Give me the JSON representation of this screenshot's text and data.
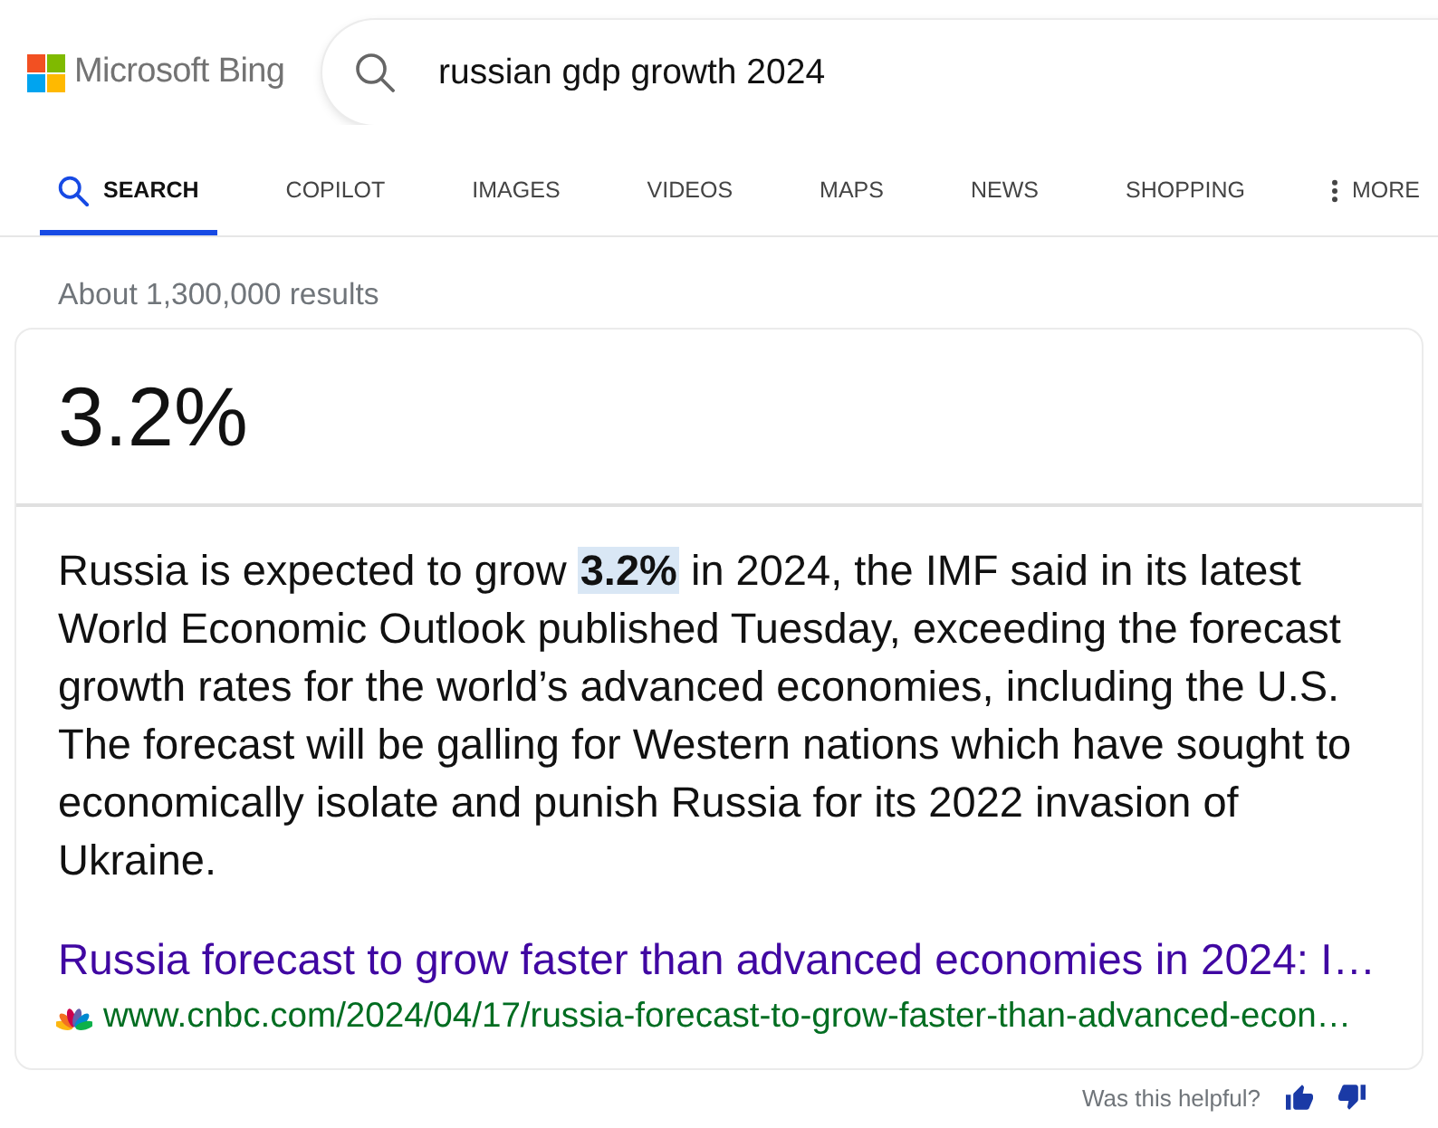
{
  "header": {
    "logo": {
      "text": "Microsoft Bing"
    },
    "search": {
      "value": "russian gdp growth 2024"
    }
  },
  "tabs": [
    {
      "label": "SEARCH",
      "kind": "search",
      "selected": true
    },
    {
      "label": "COPILOT",
      "kind": "plain",
      "selected": false
    },
    {
      "label": "IMAGES",
      "kind": "plain",
      "selected": false
    },
    {
      "label": "VIDEOS",
      "kind": "plain",
      "selected": false
    },
    {
      "label": "MAPS",
      "kind": "plain",
      "selected": false
    },
    {
      "label": "NEWS",
      "kind": "plain",
      "selected": false
    },
    {
      "label": "SHOPPING",
      "kind": "plain",
      "selected": false
    },
    {
      "label": "MORE",
      "kind": "more",
      "selected": false
    }
  ],
  "results_count": "About 1,300,000 results",
  "answer": {
    "value": "3.2%",
    "snippet": "Russia is expected to grow **3.2%** in 2024, the IMF said in its latest World Economic Outlook published Tuesday, exceeding the forecast growth rates for the world’s advanced economies, including the U.S. The forecast will be galling for Western nations which have sought to economically isolate and punish Russia for its 2022 invasion of Ukraine.",
    "source": {
      "title": "Russia forecast to grow faster than advanced economies in 2024: I…",
      "url": "www.cnbc.com/2024/04/17/russia-forecast-to-grow-faster-than-advanced-econ…"
    }
  },
  "feedback": {
    "prompt": "Was this helpful?"
  }
}
